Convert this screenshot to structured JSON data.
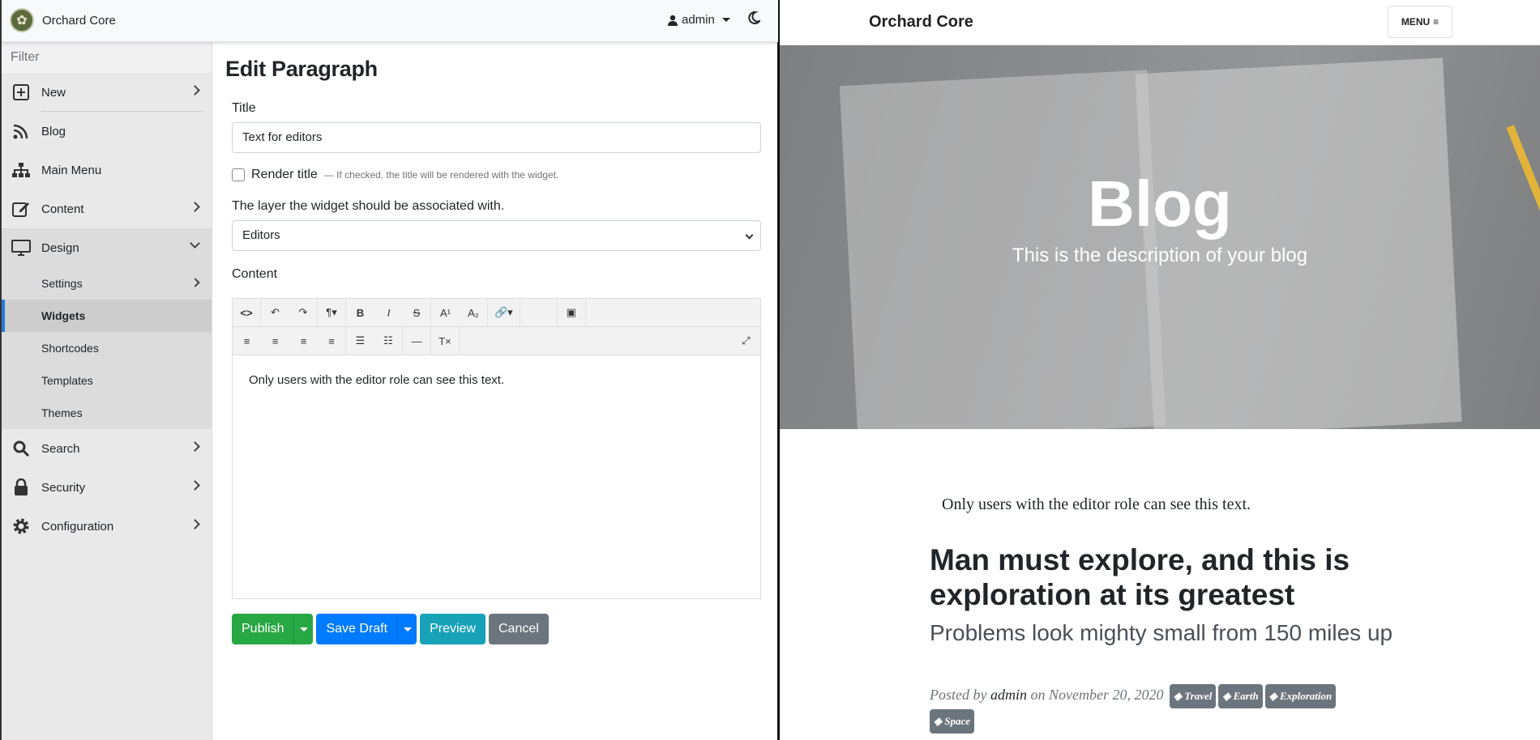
{
  "admin": {
    "brand": "Orchard Core",
    "user": "admin",
    "filter_placeholder": "Filter",
    "nav": {
      "new": "New",
      "blog": "Blog",
      "main_menu": "Main Menu",
      "content": "Content",
      "design": "Design",
      "design_sub": {
        "settings": "Settings",
        "widgets": "Widgets",
        "shortcodes": "Shortcodes",
        "templates": "Templates",
        "themes": "Themes"
      },
      "search": "Search",
      "security": "Security",
      "configuration": "Configuration"
    },
    "form": {
      "page_title": "Edit Paragraph",
      "title_label": "Title",
      "title_value": "Text for editors",
      "render_title_label": "Render title",
      "render_title_hint": "— If checked, the title will be rendered with the widget.",
      "render_title_checked": false,
      "layer_label": "The layer the widget should be associated with.",
      "layer_value": "Editors",
      "content_label": "Content",
      "content_text": "Only users with the editor role can see this text.",
      "buttons": {
        "publish": "Publish",
        "save_draft": "Save Draft",
        "preview": "Preview",
        "cancel": "Cancel"
      }
    },
    "accent_color": "#2a7ad5"
  },
  "site": {
    "brand": "Orchard Core",
    "menu_label": "MENU",
    "hero_title": "Blog",
    "hero_subtitle": "This is the description of your blog",
    "editor_note": "Only users with the editor role can see this text.",
    "post": {
      "title": "Man must explore, and this is exploration at its greatest",
      "subtitle": "Problems look mighty small from 150 miles up",
      "posted_by": "Posted by",
      "author": "admin",
      "on": "on",
      "date": "November 20, 2020",
      "tags": [
        "Travel",
        "Earth",
        "Exploration",
        "Space"
      ]
    }
  }
}
